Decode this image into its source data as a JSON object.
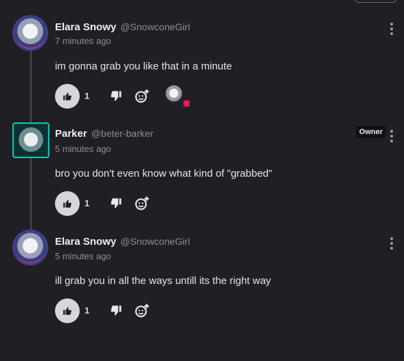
{
  "comments": [
    {
      "name": "Elara Snowy",
      "handle": "@SnowconeGirl",
      "time": "7 minutes ago",
      "text": "im gonna grab you like that in a minute",
      "likes": "1"
    },
    {
      "name": "Parker",
      "handle": "@beter-barker",
      "time": "5 minutes ago",
      "text": "bro you don't even know what kind of \"grabbed\"",
      "likes": "1",
      "badge": "Owner"
    },
    {
      "name": "Elara Snowy",
      "handle": "@SnowconeGirl",
      "time": "5 minutes ago",
      "text": "ill grab you  in all the ways untill its the right way",
      "likes": "1"
    }
  ],
  "icons": {
    "like": "thumbs-up-icon",
    "dislike": "thumbs-down-icon",
    "react": "add-reaction-icon",
    "menu": "more-vertical-icon"
  }
}
